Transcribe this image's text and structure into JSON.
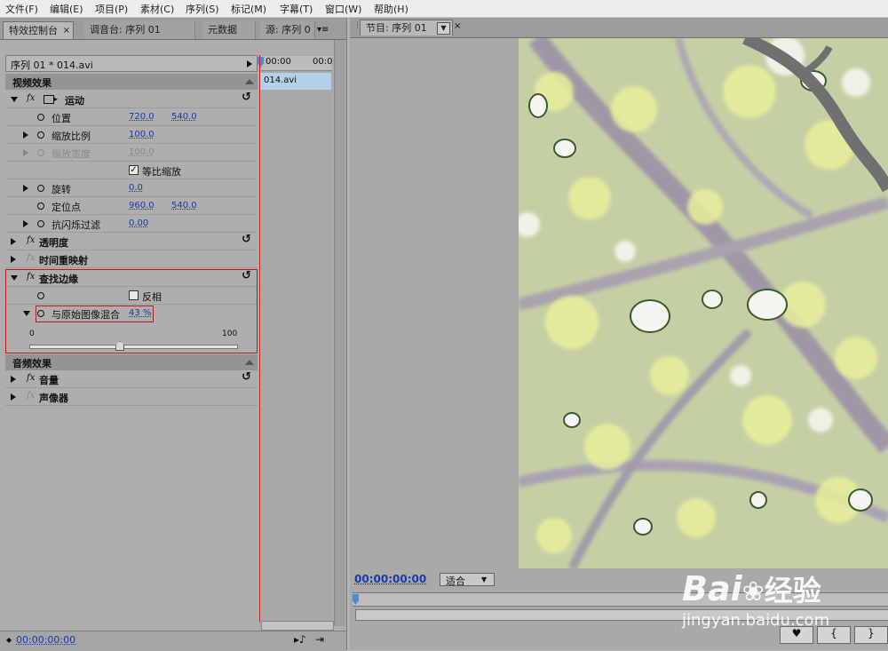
{
  "menu": [
    "文件(F)",
    "编辑(E)",
    "项目(P)",
    "素材(C)",
    "序列(S)",
    "标记(M)",
    "字幕(T)",
    "窗口(W)",
    "帮助(H)"
  ],
  "left_tabs": {
    "effect_controls": "特效控制台",
    "mixer": "调音台: 序列 01",
    "metadata": "元数据",
    "source": "源: 序列 0"
  },
  "clip_header": "序列 01 * 014.avi",
  "timeline": {
    "start": "00:00",
    "end": "00:0",
    "clip_name": "014.avi"
  },
  "video_effects": {
    "header": "视频效果",
    "motion": {
      "label": "运动",
      "position": {
        "label": "位置",
        "x": "720.0",
        "y": "540.0"
      },
      "scale": {
        "label": "缩放比例",
        "value": "100.0"
      },
      "scale_width": {
        "label": "缩放宽度",
        "value": "100.0"
      },
      "uniform_scale": {
        "label": "等比缩放",
        "checked": true
      },
      "rotation": {
        "label": "旋转",
        "value": "0.0"
      },
      "anchor": {
        "label": "定位点",
        "x": "960.0",
        "y": "540.0"
      },
      "anti_flicker": {
        "label": "抗闪烁过滤",
        "value": "0.00"
      }
    },
    "opacity": {
      "label": "透明度"
    },
    "time_remap": {
      "label": "时间重映射"
    },
    "find_edges": {
      "label": "查找边缘",
      "invert": {
        "label": "反相",
        "checked": false
      },
      "blend": {
        "label": "与原始图像混合",
        "value": "43 %"
      },
      "slider": {
        "min": "0",
        "max": "100",
        "level_percent": 43
      }
    }
  },
  "audio_effects": {
    "header": "音频效果",
    "volume": {
      "label": "音量"
    },
    "panner": {
      "label": "声像器"
    }
  },
  "left_footer_timecode": "00:00:00:00",
  "program": {
    "tab": "节目: 序列 01",
    "timecode": "00:00:00:00",
    "fit": "适合"
  },
  "watermark": {
    "brand": "Bai",
    "brand2": "经验",
    "url": "jingyan.baidu.com"
  },
  "colors": {
    "accent_blue": "#1a3aa8",
    "highlight_red": "#b02020",
    "playhead": "#d02020",
    "clip": "#b6cfe9"
  },
  "icons": [
    "stopwatch-icon",
    "reset-icon",
    "fx-icon",
    "marker-icon",
    "step-back-icon",
    "step-forward-icon",
    "export-icon",
    "audio-icon"
  ]
}
